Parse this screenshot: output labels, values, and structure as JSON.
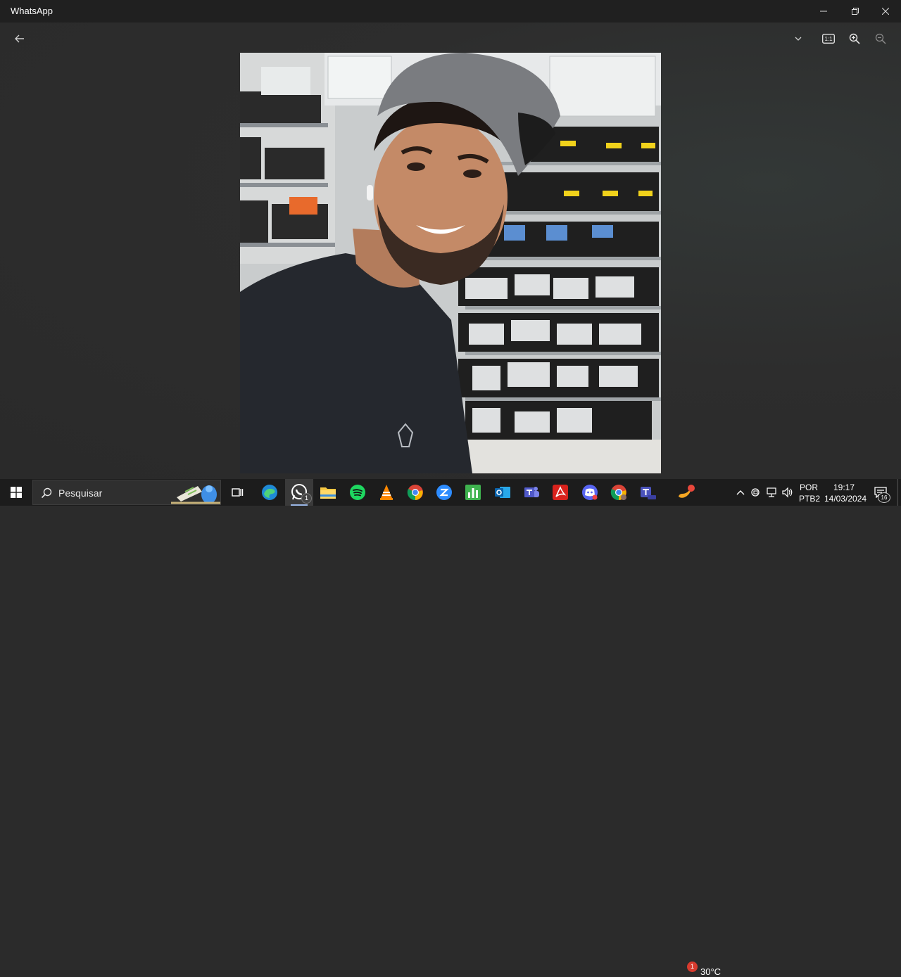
{
  "window": {
    "title": "WhatsApp"
  },
  "toolbar": {
    "back": "back-arrow-icon",
    "expand": "chevron-down-icon",
    "actual_size": "actual-size-icon",
    "actual_size_label": "1:1",
    "zoom_in": "zoom-in-icon",
    "zoom_out": "zoom-out-icon"
  },
  "photo": {
    "subject": "photo"
  },
  "taskbar": {
    "search_placeholder": "Pesquisar",
    "whatsapp_badge": "1",
    "weather_temp": "30°C",
    "weather_badge": "1",
    "language_line1": "POR",
    "language_line2": "PTB2",
    "time": "19:17",
    "date": "14/03/2024",
    "notifications_count": "16"
  }
}
